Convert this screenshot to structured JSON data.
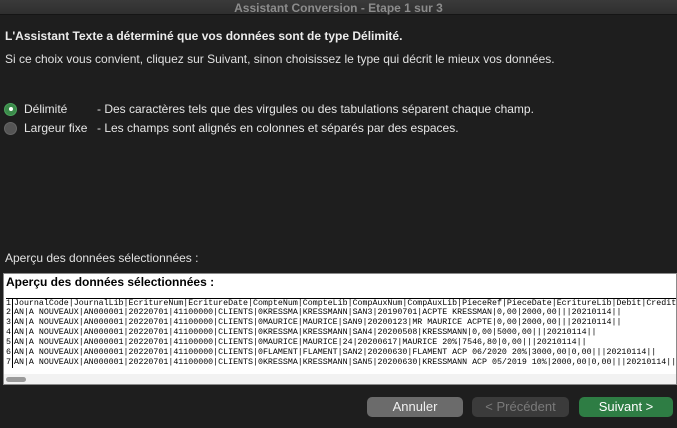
{
  "window": {
    "title": "Assistant Conversion - Etape 1 sur 3"
  },
  "intro": {
    "bold": "L'Assistant Texte a déterminé que vos données sont de type Délimité.",
    "text": "Si ce choix vous convient, cliquez sur Suivant, sinon choisissez le type qui décrit le mieux vos données."
  },
  "options": [
    {
      "label": "Délimité",
      "description": "- Des caractères tels que des virgules ou des tabulations séparent chaque champ.",
      "selected": true
    },
    {
      "label": "Largeur fixe",
      "description": "- Les champs sont alignés en colonnes et séparés par des espaces.",
      "selected": false
    }
  ],
  "preview": {
    "caption": "Aperçu des données sélectionnées :",
    "title": "Aperçu des données sélectionnées :",
    "rows": [
      {
        "num": "1",
        "text": "JournalCode|JournalLib|EcritureNum|EcritureDate|CompteNum|CompteLib|CompAuxNum|CompAuxLib|PieceRef|PieceDate|EcritureLib|Debit|Credit"
      },
      {
        "num": "2",
        "text": "AN|A NOUVEAUX|AN000001|20220701|41100000|CLIENTS|0KRESSMA|KRESSMANN|SAN3|20190701|ACPTE KRESSMAN|0,00|2000,00|||20210114||"
      },
      {
        "num": "3",
        "text": "AN|A NOUVEAUX|AN000001|20220701|41100000|CLIENTS|0MAURICE|MAURICE|SAN9|20200123|MR MAURICE ACPTE|0,00|2000,00|||20210114||"
      },
      {
        "num": "4",
        "text": "AN|A NOUVEAUX|AN000001|20220701|41100000|CLIENTS|0KRESSMA|KRESSMANN|SAN4|20200508|KRESSMANN|0,00|5000,00|||20210114||"
      },
      {
        "num": "5",
        "text": "AN|A NOUVEAUX|AN000001|20220701|41100000|CLIENTS|0MAURICE|MAURICE|24|20200617|MAURICE 20%|7546,80|0,00|||20210114||"
      },
      {
        "num": "6",
        "text": "AN|A NOUVEAUX|AN000001|20220701|41100000|CLIENTS|0FLAMENT|FLAMENT|SAN2|20200630|FLAMENT ACP 06/2020 20%|3000,00|0,00|||20210114||"
      },
      {
        "num": "7",
        "text": "AN|A NOUVEAUX|AN000001|20220701|41100000|CLIENTS|0KRESSMA|KRESSMANN|SAN5|20200630|KRESSMANN ACP 05/2019 10%|2000,00|0,00|||20210114||"
      }
    ]
  },
  "buttons": {
    "cancel": "Annuler",
    "previous": "< Précédent",
    "next": "Suivant >"
  },
  "colors": {
    "accent": "#2e7d44",
    "background": "#1e1e1e"
  }
}
